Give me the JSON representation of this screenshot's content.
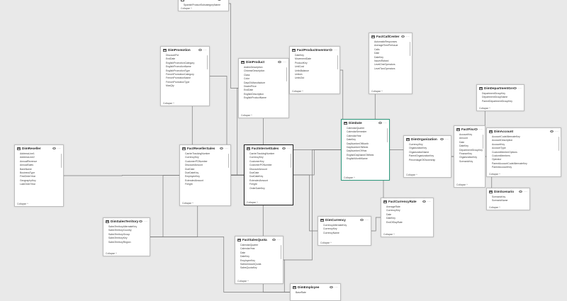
{
  "view": {
    "background": "#e9e9e9",
    "line_color": "#7a7a7a",
    "card_border": "#bdbdbd",
    "highlight_color": "#2e9a7e"
  },
  "icons": {
    "table": "table-icon",
    "visibility": "eye-icon",
    "more": "more-options-icon"
  },
  "collapse_label": "Collapse ^",
  "tables": [
    {
      "id": "top-table",
      "name": "",
      "fields": [
        "SpanishProductSubcategoryName"
      ],
      "footer": "Collapse ^",
      "state": "normal"
    },
    {
      "id": "dimpromotion",
      "name": "DimPromotion",
      "fields": [
        "DiscountPct",
        "EndDate",
        "EnglishPromotionCategory",
        "EnglishPromotionName",
        "EnglishPromotionType",
        "FrenchPromotionCategory",
        "FrenchPromotionName",
        "FrenchPromotionType",
        "MaxQty"
      ],
      "footer": "Collapse ^",
      "state": "normal"
    },
    {
      "id": "dimproduct",
      "name": "DimProduct",
      "fields": [
        "ArabicDescription",
        "ChineseDescription",
        "Class",
        "Color",
        "DaysToManufacture",
        "DealerPrice",
        "EndDate",
        "EnglishDescription",
        "EnglishProductName"
      ],
      "footer": "Collapse ^",
      "state": "normal"
    },
    {
      "id": "factproductinventory",
      "name": "FactProductInventory",
      "fields": [
        "DateKey",
        "MovementDate",
        "ProductKey",
        "UnitCost",
        "UnitsBalance",
        "UnitsIn",
        "UnitsOut"
      ],
      "footer": "Collapse ^",
      "state": "normal"
    },
    {
      "id": "factcallcenter",
      "name": "FactCallCenter",
      "fields": [
        "AutomaticResponses",
        "AverageTimePerIssue",
        "Calls",
        "Date",
        "DateKey",
        "IssuesRaised",
        "LevelOneOperators",
        "LevelTwoOperators"
      ],
      "footer": "Collapse ^",
      "state": "normal"
    },
    {
      "id": "dimdepartmentgroup",
      "name": "DimDepartmentGroup",
      "fields": [
        "DepartmentGroupKey",
        "DepartmentGroupName",
        "ParentDepartmentGroupKey"
      ],
      "footer": "Collapse ^",
      "state": "normal"
    },
    {
      "id": "dimaccount",
      "name": "DimAccount",
      "fields": [
        "AccountCodeAlternateKey",
        "AccountDescription",
        "AccountKey",
        "AccountType",
        "CustomMemberOptions",
        "CustomMembers",
        "Operator",
        "ParentAccountCodeAlternateKey",
        "ParentAccountKey"
      ],
      "footer": "Collapse ^",
      "state": "normal"
    },
    {
      "id": "dimreseller",
      "name": "DimReseller",
      "fields": [
        "AddressLine1",
        "AddressLine2",
        "AnnualRevenue",
        "AnnualSales",
        "BankName",
        "BusinessType",
        "FirstOrderYear",
        "GeographyKey",
        "LastOrderYear"
      ],
      "footer": "Collapse ^",
      "state": "normal"
    },
    {
      "id": "factresellersales",
      "name": "FactResellerSales",
      "fields": [
        "CarrierTrackingNumber",
        "CurrencyKey",
        "CustomerPONumber",
        "DiscountAmount",
        "DueDate",
        "DueDateKey",
        "EmployeeKey",
        "ExtendedAmount",
        "Freight"
      ],
      "footer": "Collapse ^",
      "state": "normal"
    },
    {
      "id": "factinternetsales",
      "name": "FactInternetSales",
      "fields": [
        "CarrierTrackingNumber",
        "CurrencyKey",
        "CustomerKey",
        "CustomerPONumber",
        "DiscountAmount",
        "DueDate",
        "DueDateKey",
        "ExtendedAmount",
        "Freight",
        "OrderDateKey"
      ],
      "footer": "Collapse ^",
      "state": "selected"
    },
    {
      "id": "dimdate",
      "name": "DimDate",
      "fields": [
        "CalendarQuarter",
        "CalendarSemester",
        "CalendarYear",
        "DateKey",
        "DayNumberOfMonth",
        "DayNumberOfWeek",
        "DayNumberOfYear",
        "EnglishDayNameOfWeek",
        "EnglishMonthName"
      ],
      "footer": "Collapse ^",
      "state": "highlighted"
    },
    {
      "id": "dimorganization",
      "name": "DimOrganization",
      "fields": [
        "CurrencyKey",
        "OrganizationKey",
        "OrganizationName",
        "ParentOrganizationKey",
        "PercentageOfOwnership"
      ],
      "footer": "Collapse ^",
      "state": "normal"
    },
    {
      "id": "factfinance",
      "name": "FactFinance",
      "fields": [
        "AccountKey",
        "Amount",
        "Date",
        "DateKey",
        "DepartmentGroupKey",
        "FinanceKey",
        "OrganizationKey",
        "ScenarioKey"
      ],
      "footer": "Collapse ^",
      "state": "normal"
    },
    {
      "id": "dimscenario",
      "name": "DimScenario",
      "fields": [
        "ScenarioKey",
        "ScenarioName"
      ],
      "footer": "Collapse ^",
      "state": "normal"
    },
    {
      "id": "factcurrencyrate",
      "name": "FactCurrencyRate",
      "fields": [
        "AverageRate",
        "CurrencyKey",
        "Date",
        "DateKey",
        "EndOfDayRate"
      ],
      "footer": "Collapse ^",
      "state": "normal"
    },
    {
      "id": "dimcurrency",
      "name": "DimCurrency",
      "fields": [
        "CurrencyAlternateKey",
        "CurrencyKey",
        "CurrencyName"
      ],
      "footer": "Collapse ^",
      "state": "normal"
    },
    {
      "id": "dimsalesterritory",
      "name": "DimSalesTerritory",
      "fields": [
        "SalesTerritoryAlternateKey",
        "SalesTerritoryCountry",
        "SalesTerritoryGroup",
        "SalesTerritoryKey",
        "SalesTerritoryRegion"
      ],
      "footer": "Collapse ^",
      "state": "normal"
    },
    {
      "id": "factsalesquota",
      "name": "FactSalesQuota",
      "fields": [
        "CalendarQuarter",
        "CalendarYear",
        "Date",
        "DateKey",
        "EmployeeKey",
        "SalesAmountQuota",
        "SalesQuotaKey"
      ],
      "footer": "Collapse ^",
      "state": "normal"
    },
    {
      "id": "dimemployee",
      "name": "DimEmployee",
      "fields": [
        "BaseRate"
      ],
      "footer": "",
      "state": "normal"
    }
  ],
  "relationships": [
    [
      "dimpromotion",
      "factresellersales"
    ],
    [
      "dimpromotion",
      "factinternetsales"
    ],
    [
      "dimproduct",
      "factresellersales"
    ],
    [
      "dimproduct",
      "factinternetsales"
    ],
    [
      "dimproduct",
      "factproductinventory"
    ],
    [
      "factproductinventory",
      "dimdate"
    ],
    [
      "factcallcenter",
      "dimdate"
    ],
    [
      "dimreseller",
      "factresellersales"
    ],
    [
      "factresellersales",
      "dimdate"
    ],
    [
      "factinternetsales",
      "dimdate"
    ],
    [
      "dimdate",
      "factfinance"
    ],
    [
      "dimorganization",
      "factfinance"
    ],
    [
      "dimaccount",
      "factfinance"
    ],
    [
      "dimdepartmentgroup",
      "factfinance"
    ],
    [
      "dimscenario",
      "factfinance"
    ],
    [
      "dimdate",
      "factcurrencyrate"
    ],
    [
      "dimcurrency",
      "factcurrencyrate"
    ],
    [
      "dimcurrency",
      "factinternetsales"
    ],
    [
      "dimsalesterritory",
      "factresellersales"
    ],
    [
      "dimsalesterritory",
      "factinternetsales"
    ],
    [
      "dimsalesterritory",
      "dimemployee"
    ],
    [
      "factsalesquota",
      "dimemployee"
    ],
    [
      "factsalesquota",
      "dimdate"
    ],
    [
      "dimemployee",
      "factresellersales"
    ],
    [
      "top-table",
      "dimproduct"
    ]
  ]
}
